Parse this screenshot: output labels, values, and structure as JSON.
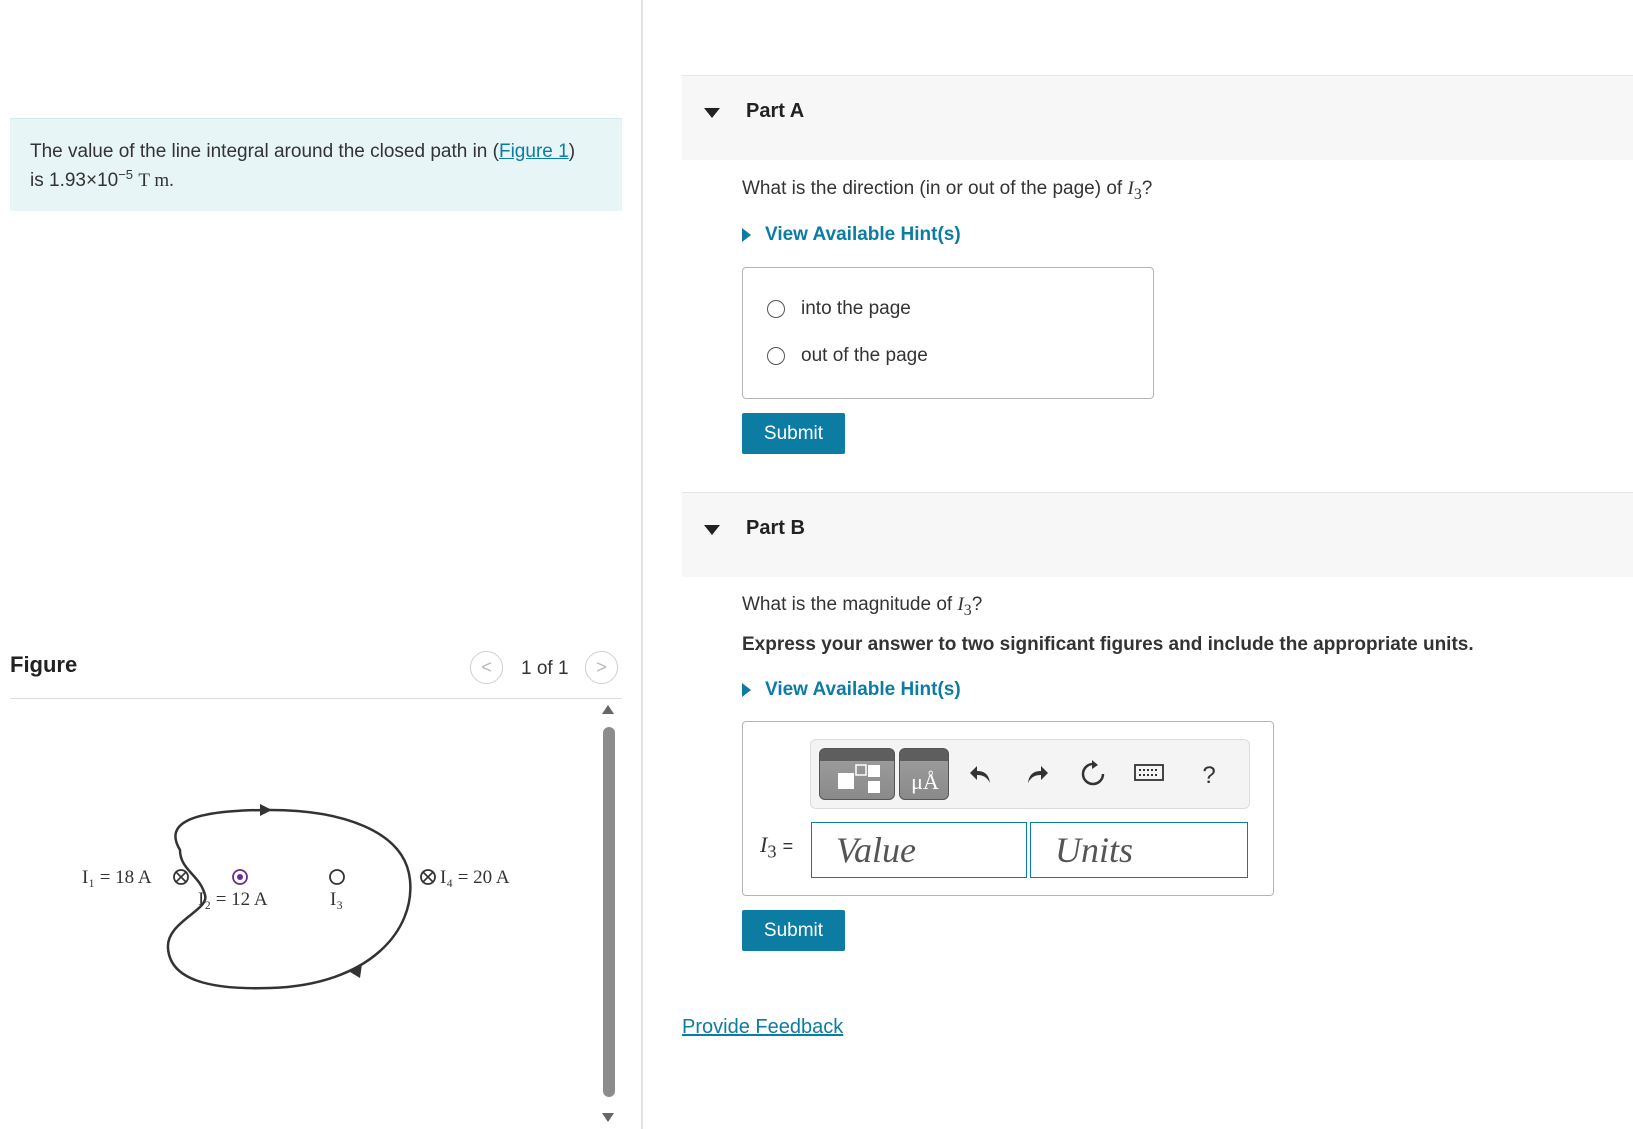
{
  "intro": {
    "text_before": "The value of the line integral around the closed path in (",
    "figure_link": "Figure 1",
    "text_after": ")",
    "line2_prefix": "is 1.93×10",
    "exponent": "−5",
    "unit": "T m."
  },
  "figure_panel": {
    "heading": "Figure",
    "prev_label": "<",
    "count": "1 of 1",
    "next_label": ">",
    "labels": {
      "i1": "I₁ = 18 A",
      "i2": "I₂ = 12 A",
      "i3": "I₃",
      "i4": "I₄ = 20 A"
    }
  },
  "part_a": {
    "title": "Part A",
    "question_before": "What is the direction (in or out of the page) of ",
    "question_var": "I",
    "question_sub": "3",
    "question_after": "?",
    "hint": "View Available Hint(s)",
    "options": [
      "into the page",
      "out of the page"
    ],
    "submit": "Submit"
  },
  "part_b": {
    "title": "Part B",
    "question_before": "What is the magnitude of ",
    "question_var": "I",
    "question_sub": "3",
    "question_after": "?",
    "instructions": "Express your answer to two significant figures and include the appropriate units.",
    "hint": "View Available Hint(s)",
    "toolbar": {
      "units_tool": "μÅ",
      "help": "?",
      "icons": [
        "templates-icon",
        "units-icon",
        "undo-icon",
        "redo-icon",
        "reset-icon",
        "keyboard-icon",
        "help-icon"
      ]
    },
    "eq_var": "I",
    "eq_sub": "3",
    "eq_sign": "=",
    "value_placeholder": "Value",
    "units_placeholder": "Units",
    "submit": "Submit"
  },
  "feedback": "Provide Feedback",
  "colors": {
    "accent": "#0d7ca3",
    "intro_bg": "#e7f5f7",
    "header_bg": "#f7f7f7"
  }
}
